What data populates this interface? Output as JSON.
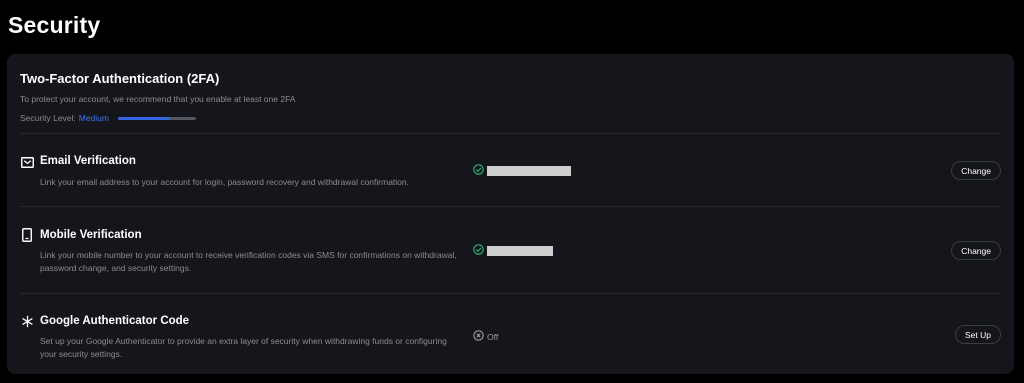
{
  "page": {
    "title": "Security"
  },
  "tfa": {
    "title": "Two-Factor Authentication (2FA)",
    "subtitle": "To protect your account, we recommend that you enable at least one 2FA",
    "security_level_label": "Security Level:",
    "security_level_value": "Medium",
    "security_level_fraction": 0.67,
    "accent_color": "#3366e0"
  },
  "sections": [
    {
      "icon": "envelope-icon",
      "title": "Email Verification",
      "description": "Link your email address to your account for login, password recovery and withdrawal confirmation.",
      "status_icon": "check-circle-icon",
      "status_text": "",
      "button_label": "Change"
    },
    {
      "icon": "mobile-phone-icon",
      "title": "Mobile Verification",
      "description": "Link your mobile number to your account to receive verification codes via SMS for confirmations on withdrawal, password change, and security settings.",
      "status_icon": "check-circle-icon",
      "status_text": "",
      "button_label": "Change"
    },
    {
      "icon": "asterisk-icon",
      "title": "Google Authenticator Code",
      "description": "Set up your Google Authenticator to provide an extra layer of security when withdrawing funds or configuring your security settings.",
      "status_icon": "x-circle-icon",
      "status_text": "Off",
      "button_label": "Set Up"
    }
  ],
  "colors": {
    "page_bg": "#000000",
    "card_bg": "#15161b",
    "success": "#2fb67c",
    "muted": "#8a8c93"
  }
}
